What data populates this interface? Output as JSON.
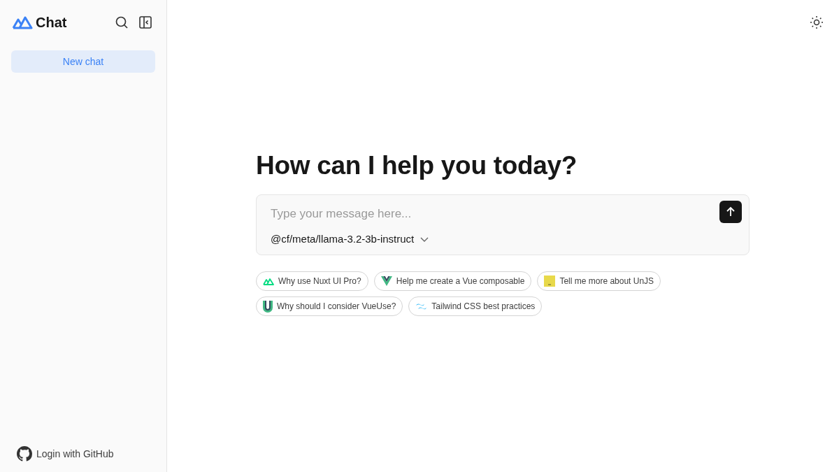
{
  "sidebar": {
    "app_title": "Chat",
    "new_chat": "New chat",
    "login": "Login with GitHub"
  },
  "main": {
    "heading": "How can I help you today?",
    "composer": {
      "placeholder": "Type your message here...",
      "model": "@cf/meta/llama-3.2-3b-instruct"
    },
    "suggestions": [
      {
        "kind": "nuxt",
        "label": "Why use Nuxt UI Pro?"
      },
      {
        "kind": "vue",
        "label": "Help me create a Vue composable"
      },
      {
        "kind": "unjs",
        "label": "Tell me more about UnJS"
      },
      {
        "kind": "vueuse",
        "label": "Why should I consider VueUse?"
      },
      {
        "kind": "tailwind",
        "label": "Tailwind CSS best practices"
      }
    ]
  }
}
